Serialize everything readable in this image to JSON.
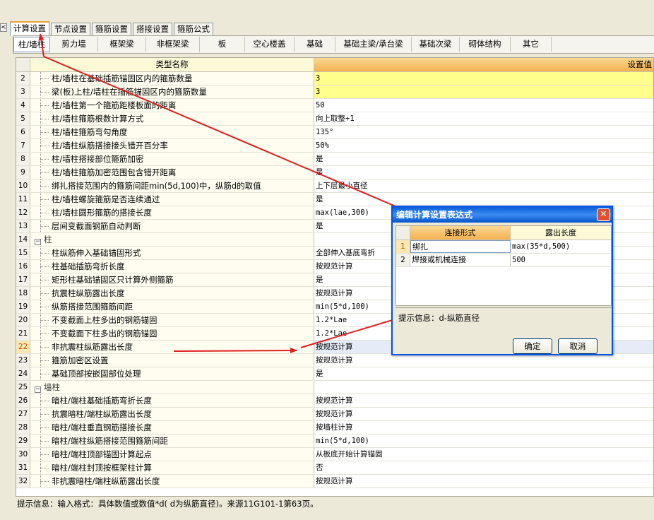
{
  "colors": {
    "arrow": "#e02020",
    "accent_header": "#f3b14f",
    "highlight": "#ffff8c",
    "dialog_title": "#0a5fd8"
  },
  "top_tabs": [
    "计算设置",
    "节点设置",
    "箍筋设置",
    "搭接设置",
    "箍筋公式"
  ],
  "sub_tabs": [
    "柱/墙柱",
    "剪力墙",
    "框架梁",
    "非框架梁",
    "板",
    "空心楼盖",
    "基础",
    "基础主梁/承台梁",
    "基础次梁",
    "砌体结构",
    "其它"
  ],
  "grid": {
    "col_name": "类型名称",
    "col_value": "设置值",
    "rows": [
      {
        "n": "2",
        "name": "柱/墙柱在基础插筋锚固区内的箍筋数量",
        "value": "3"
      },
      {
        "n": "3",
        "name": "梁(板)上柱/墙柱在插筋锚固区内的箍筋数量",
        "value": "3"
      },
      {
        "n": "4",
        "name": "柱/墙柱第一个箍筋距楼板面的距离",
        "value": "50"
      },
      {
        "n": "5",
        "name": "柱/墙柱箍筋根数计算方式",
        "value": "向上取整+1"
      },
      {
        "n": "6",
        "name": "柱/墙柱箍筋弯勾角度",
        "value": "135°"
      },
      {
        "n": "7",
        "name": "柱/墙柱纵筋搭接接头错开百分率",
        "value": "50%"
      },
      {
        "n": "8",
        "name": "柱/墙柱搭接部位箍筋加密",
        "value": "是"
      },
      {
        "n": "9",
        "name": "柱/墙柱箍筋加密范围包含错开距离",
        "value": "是"
      },
      {
        "n": "10",
        "name": "绑扎搭接范围内的箍筋间距min(5d,100)中，纵筋d的取值",
        "value": "上下层最小直径"
      },
      {
        "n": "11",
        "name": "柱/墙柱螺旋箍筋是否连续通过",
        "value": "是"
      },
      {
        "n": "12",
        "name": "柱/墙柱圆形箍筋的搭接长度",
        "value": "max(lae,300)"
      },
      {
        "n": "13",
        "name": "层间变截面钢筋自动判断",
        "value": "是"
      },
      {
        "n": "14",
        "name": "柱",
        "value": ""
      },
      {
        "n": "15",
        "name": "柱纵筋伸入基础锚固形式",
        "value": "全部伸入基底弯折"
      },
      {
        "n": "16",
        "name": "柱基础插筋弯折长度",
        "value": "按规范计算"
      },
      {
        "n": "17",
        "name": "矩形柱基础锚固区只计算外侧箍筋",
        "value": "是"
      },
      {
        "n": "18",
        "name": "抗震柱纵筋露出长度",
        "value": "按规范计算"
      },
      {
        "n": "19",
        "name": "纵筋搭接范围箍筋间距",
        "value": "min(5*d,100)"
      },
      {
        "n": "20",
        "name": "不变截面上柱多出的钢筋锚固",
        "value": "1.2*Lae"
      },
      {
        "n": "21",
        "name": "不变截面下柱多出的钢筋锚固",
        "value": "1.2*Lae"
      },
      {
        "n": "22",
        "name": "非抗震柱纵筋露出长度",
        "value": "按规范计算"
      },
      {
        "n": "23",
        "name": "箍筋加密区设置",
        "value": "按规范计算"
      },
      {
        "n": "24",
        "name": "基础顶部按嵌固部位处理",
        "value": "是"
      },
      {
        "n": "25",
        "name": "墙柱",
        "value": ""
      },
      {
        "n": "26",
        "name": "暗柱/端柱基础插筋弯折长度",
        "value": "按规范计算"
      },
      {
        "n": "27",
        "name": "抗震暗柱/端柱纵筋露出长度",
        "value": "按规范计算"
      },
      {
        "n": "28",
        "name": "暗柱/端柱垂直钢筋搭接长度",
        "value": "按墙柱计算"
      },
      {
        "n": "29",
        "name": "暗柱/端柱纵筋搭接范围箍筋间距",
        "value": "min(5*d,100)"
      },
      {
        "n": "30",
        "name": "暗柱/端柱顶部锚固计算起点",
        "value": "从板底开始计算锚固"
      },
      {
        "n": "31",
        "name": "暗柱/端柱封顶按框架柱计算",
        "value": "否"
      },
      {
        "n": "32",
        "name": "非抗震暗柱/端柱纵筋露出长度",
        "value": "按规范计算"
      }
    ]
  },
  "status": "提示信息：输入格式：具体数值或数值*d( d为纵筋直径)。来源11G101-1第63页。",
  "dialog": {
    "title": "编辑计算设置表达式",
    "close": "✕",
    "col1": "连接形式",
    "col2": "露出长度",
    "rows": [
      {
        "n": "1",
        "type": "绑扎",
        "length": "max(35*d,500)"
      },
      {
        "n": "2",
        "type": "焊接或机械连接",
        "length": "500"
      }
    ],
    "hint": "提示信息：d-纵筋直径",
    "ok": "确定",
    "cancel": "取消"
  },
  "left_stub": "<"
}
